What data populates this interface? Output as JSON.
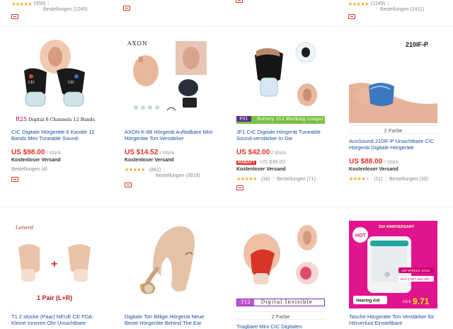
{
  "top": [
    {
      "count": "(555)",
      "sold": "Bestellungen (1245)",
      "has_rating": true
    },
    {
      "count": "",
      "sold": "",
      "has_rating": false
    },
    {
      "count": "(1249)",
      "sold": "Bestellungen (2411)",
      "has_rating": true
    }
  ],
  "stars_full": "★★★★★",
  "stars_4": "★★★★",
  "row1": [
    {
      "caption_left": "R25",
      "caption_right": "Digital 6 Channels 12 Bands",
      "title": "CIC Digitale Hörgeräte 6 Kanäle 12 Bands Mini Tuneable Sound-",
      "price": "US $98.00",
      "unit": "/ stück",
      "ship": "Kostenloser Versand",
      "sold": "Bestellungen (4)"
    },
    {
      "brand": "AXON",
      "title": "AXON K-88 Hörgerät Aufladbare Mini Hörgeräte Ton Verstärker",
      "price": "US $14.52",
      "unit": "/ stück",
      "ship": "Kostenloser Versand",
      "rating_count": "(861)",
      "sold": "Bestellungen (3919)"
    },
    {
      "banner_left": "F01",
      "banner_right": "Battery 312 Working Longer",
      "title": "JF1 CIC Digitale Hörgerät Tuneable Sound-verstärker In Die",
      "price": "US $42.00",
      "unit": "/ stück",
      "rabatt": "RABATT",
      "old_price": "US $39.00",
      "ship": "Kostenloser Versand",
      "rating_count": "(34)",
      "sold": "Bestellungen (71)"
    },
    {
      "model": "210IF-P",
      "colors": "2 Farbe",
      "title": "AcoSound 210IF-P Unsichtbare CIC Hörgerät Digitale Hörgeräte",
      "price": "US $88.00",
      "unit": "/ stück",
      "ship": "Kostenloser Versand",
      "rating_count": "(11)",
      "sold": "Bestellungen (30)"
    }
  ],
  "row2": [
    {
      "logo": "Lenerd",
      "plus": "+",
      "pair_label": "1 Pair (L+R)",
      "title": "T1 2 stücke (Paar) NEUE CE FDA Kleine Inneren Ohr Unsichtbare"
    },
    {
      "title": "Digitale Ton Billige Hörgerät Neue Beste Hörgeräte Behind The Ear"
    },
    {
      "banner_left": "T12",
      "banner_right": "Digital Invisible",
      "colors": "2 Farbe",
      "title": "Tragbare Mini CIC Digitalen"
    },
    {
      "anniversary": "22# ANNIVERSARY",
      "hot": "HOT",
      "sale1": "12# SPECIAL SALE",
      "sale2": "BUY 2 GET 10% OFF",
      "hearing": "Hearing Aid",
      "us": "US $",
      "promo_price": "9.71",
      "title": "Tasche Hörgeräte Ton Verstärker für Hörverlust Einstellbare"
    }
  ],
  "colors": {
    "price_red": "#e43225",
    "link_blue": "#1a4fa0",
    "star": "#f5a623",
    "skin": "#e8b89c",
    "promo_pink": "#e0148c"
  }
}
